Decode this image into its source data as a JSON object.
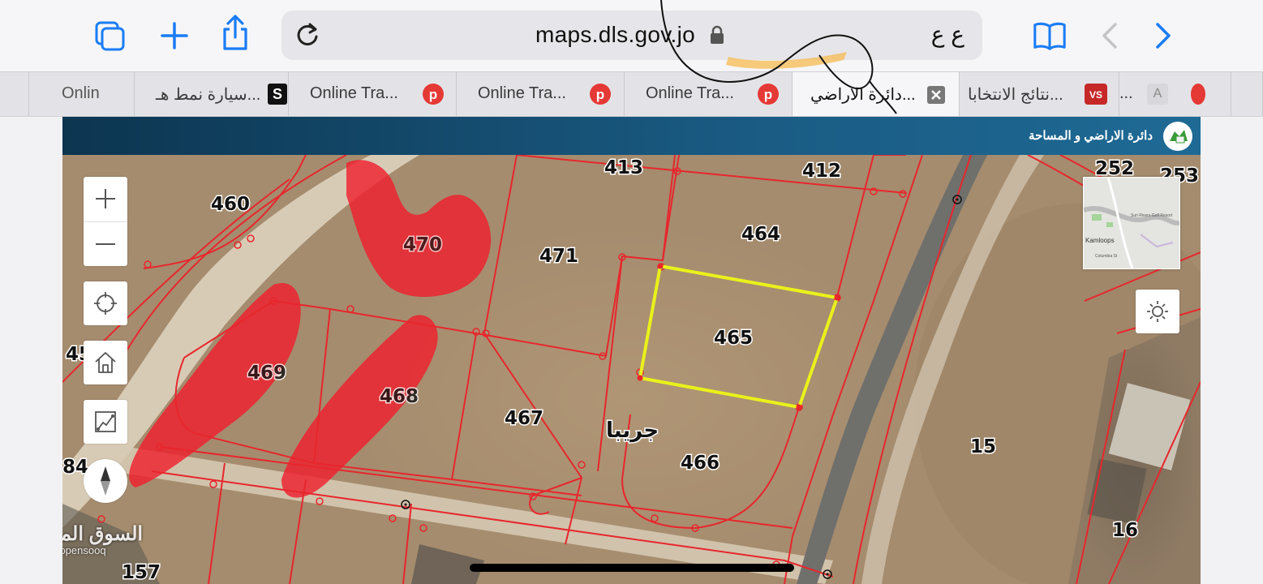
{
  "browser": {
    "url": "maps.dls.gov.jo",
    "reader_label": "ع ع",
    "icons": [
      "tabs-icon",
      "new-tab-icon",
      "share-icon",
      "reload-icon",
      "lock-icon",
      "bookmarks-icon",
      "back-icon",
      "forward-icon"
    ]
  },
  "tabs": [
    {
      "label": "Onlin",
      "favicon": "none"
    },
    {
      "label": "سيارة نمط هـ...",
      "favicon": "S"
    },
    {
      "label": "Online Tra...",
      "favicon": "p"
    },
    {
      "label": "Online Tra...",
      "favicon": "p"
    },
    {
      "label": "Online Tra...",
      "favicon": "p"
    },
    {
      "label": "دائرة الاراضي...",
      "favicon": "close",
      "active": true
    },
    {
      "label": "نتائج الانتخابا...",
      "favicon": "VS"
    },
    {
      "label": "...",
      "favicon": "A"
    }
  ],
  "page": {
    "header_title": "دائرة الاراضي و المساحة"
  },
  "map": {
    "controls": [
      "zoom-in",
      "zoom-out",
      "locate",
      "home",
      "measure",
      "compass"
    ],
    "basemap_thumb": {
      "label1": "Kamloops",
      "label2": "Sun Rivers Golf Resort",
      "label3": "Columbia St"
    },
    "area_name": "جريبا",
    "selected_parcel": "465",
    "parcels": [
      "460",
      "413",
      "412",
      "470",
      "471",
      "464",
      "465",
      "469",
      "468",
      "467",
      "466",
      "15",
      "16",
      "252",
      "253",
      "45",
      "84",
      "157"
    ],
    "watermark": "السوق المفتوح",
    "watermark_sub": "opensooq"
  },
  "colors": {
    "parcel_line": "#e8262d",
    "selected_outline": "#e9f21a",
    "header": "#134a6d",
    "highlight": "#f5ba52"
  }
}
